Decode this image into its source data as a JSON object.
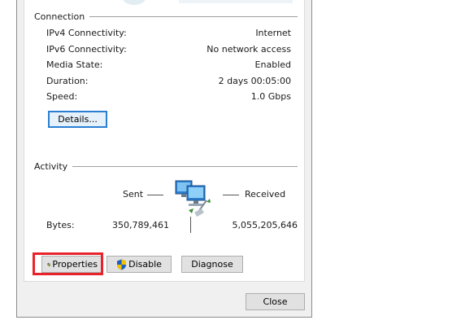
{
  "connection": {
    "title": "Connection",
    "rows": [
      {
        "label": "IPv4 Connectivity:",
        "value": "Internet"
      },
      {
        "label": "IPv6 Connectivity:",
        "value": "No network access"
      },
      {
        "label": "Media State:",
        "value": "Enabled"
      },
      {
        "label": "Duration:",
        "value": "2 days 00:05:00"
      },
      {
        "label": "Speed:",
        "value": "1.0 Gbps"
      }
    ],
    "details_label": "Details..."
  },
  "activity": {
    "title": "Activity",
    "sent_label": "Sent",
    "received_label": "Received",
    "bytes_label": "Bytes:",
    "bytes_sent": "350,789,461",
    "bytes_received": "5,055,205,646"
  },
  "buttons": {
    "properties": "Properties",
    "disable": "Disable",
    "diagnose": "Diagnose",
    "close": "Close"
  },
  "colors": {
    "highlight": "#e8232a",
    "focus_border": "#2b7fd2",
    "shield_blue": "#1f5fbf",
    "shield_yellow": "#f2c200"
  },
  "icons": {
    "network": "network-computers-icon",
    "shield": "uac-shield-icon"
  }
}
